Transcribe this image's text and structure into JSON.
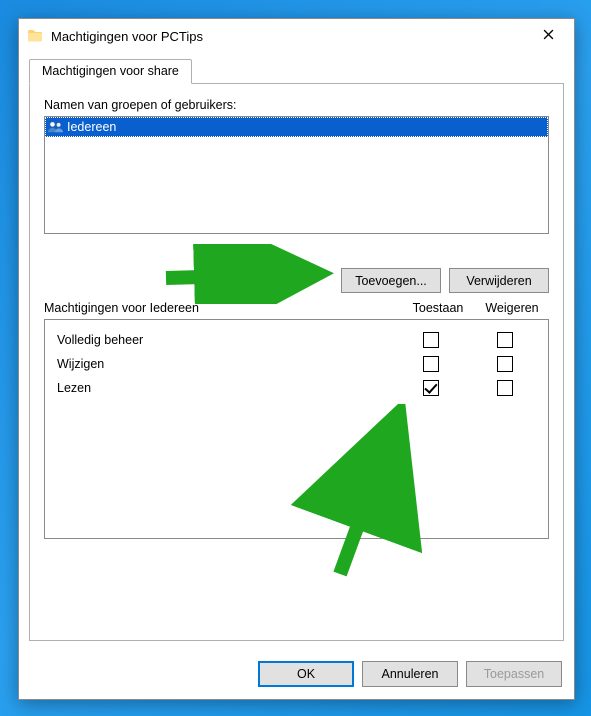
{
  "window": {
    "title": "Machtigingen voor PCTips"
  },
  "tabs": {
    "share": "Machtigingen voor share"
  },
  "groups_label": "Namen van groepen of gebruikers:",
  "principals": [
    {
      "name": "Iedereen",
      "selected": true
    }
  ],
  "buttons": {
    "add": "Toevoegen...",
    "remove": "Verwijderen",
    "ok": "OK",
    "cancel": "Annuleren",
    "apply": "Toepassen"
  },
  "permissions_header": {
    "label": "Machtigingen voor Iedereen",
    "allow": "Toestaan",
    "deny": "Weigeren"
  },
  "permissions": [
    {
      "name": "Volledig beheer",
      "allow": false,
      "deny": false
    },
    {
      "name": "Wijzigen",
      "allow": false,
      "deny": false
    },
    {
      "name": "Lezen",
      "allow": true,
      "deny": false
    }
  ],
  "colors": {
    "selection": "#0a5fcf",
    "win_accent": "#0078d7",
    "arrow": "#1fa81f"
  }
}
